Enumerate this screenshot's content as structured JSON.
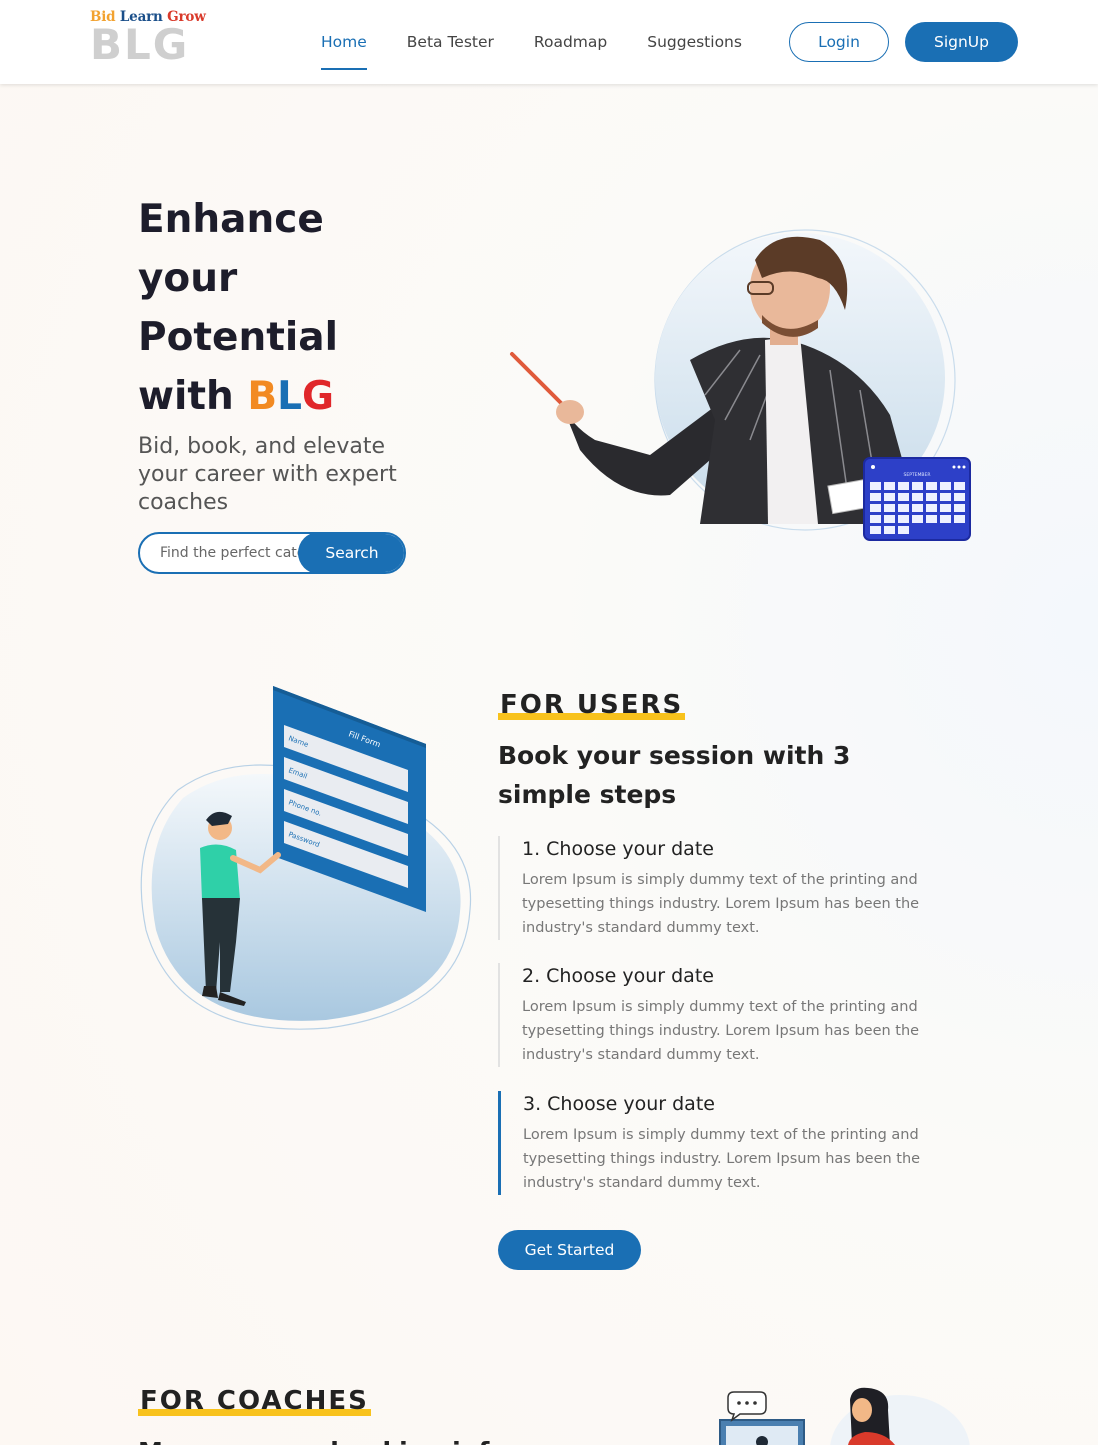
{
  "brand": {
    "tagline_words": [
      "Bid",
      "Learn",
      "Grow"
    ],
    "mark": "BLG"
  },
  "nav": {
    "items": [
      {
        "label": "Home",
        "active": true
      },
      {
        "label": "Beta Tester",
        "active": false
      },
      {
        "label": "Roadmap",
        "active": false
      },
      {
        "label": "Suggestions",
        "active": false
      }
    ],
    "login_label": "Login",
    "signup_label": "SignUp"
  },
  "hero": {
    "title_lines": [
      "Enhance",
      "your",
      "Potential",
      "with"
    ],
    "title_brand": [
      "B",
      "L",
      "G"
    ],
    "subtitle": "Bid, book, and elevate your career with expert coaches",
    "search_placeholder": "Find the perfect category",
    "search_button": "Search",
    "calendar_month": "SEPTEMBER"
  },
  "users": {
    "kicker": "FOR USERS",
    "heading": "Book your session with 3 simple steps",
    "form_labels": {
      "title": "Fill Form",
      "fields": [
        "Name",
        "Email",
        "Phone no.",
        "Password"
      ]
    },
    "steps": [
      {
        "title": "1. Choose your date",
        "desc": "Lorem Ipsum is simply dummy text of the printing and typesetting things industry. Lorem Ipsum has been the industry's standard dummy text."
      },
      {
        "title": "2. Choose your date",
        "desc": "Lorem Ipsum is simply dummy text of the printing and typesetting things industry. Lorem Ipsum has been the industry's standard dummy text."
      },
      {
        "title": "3. Choose your date",
        "desc": "Lorem Ipsum is simply dummy text of the printing and typesetting things industry. Lorem Ipsum has been the industry's standard dummy text."
      }
    ],
    "active_step": 3,
    "cta_label": "Get Started"
  },
  "coaches": {
    "kicker": "FOR COACHES",
    "heading": "Manage your booking info"
  },
  "colors": {
    "primary": "#1a6fb4",
    "accent_yellow": "#f8c21c",
    "brand_orange": "#f28a22",
    "brand_red": "#e0272a"
  }
}
